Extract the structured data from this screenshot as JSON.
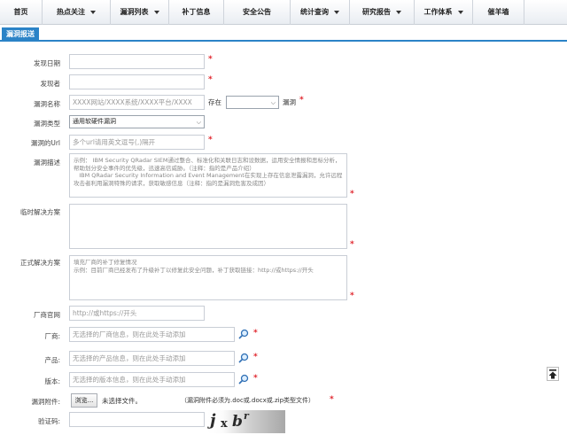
{
  "nav": {
    "items": [
      {
        "label": "首页",
        "caret": false
      },
      {
        "label": "热点关注",
        "caret": true
      },
      {
        "label": "漏洞列表",
        "caret": true
      },
      {
        "label": "补丁信息",
        "caret": false
      },
      {
        "label": "安全公告",
        "caret": false
      },
      {
        "label": "统计查询",
        "caret": true
      },
      {
        "label": "研究报告",
        "caret": true
      },
      {
        "label": "工作体系",
        "caret": true
      },
      {
        "label": "催羊墙",
        "caret": false
      }
    ]
  },
  "tab": {
    "label": "漏洞报送"
  },
  "form": {
    "discover_date": {
      "label": "发现日期",
      "value": ""
    },
    "discoverer": {
      "label": "发现者",
      "value": ""
    },
    "vuln_name": {
      "label": "漏洞名称",
      "placeholder": "XXXX网站/XXXX系统/XXXX平台/XXXX",
      "exists_label": "存在",
      "select_value": "",
      "suffix": "漏洞"
    },
    "vuln_type": {
      "label": "漏洞类型",
      "value": "通用软硬件漏洞"
    },
    "vuln_url": {
      "label": "漏洞的Url",
      "placeholder": "多个url请用英文逗号(,)隔开"
    },
    "vuln_desc": {
      "label": "漏洞描述",
      "placeholder": "示例： IBM Security QRadar SIEM通过整合、标准化和关联日志和设数据，运用安全情报和恶标分析，帮助划分安全事件的优先级，迅速高信威胁。（注释：指的是产品介绍）\n   IBM QRadar Security Information and Event Management在实现上存在信息泄露漏洞，允许远程攻击者利用漏洞特殊的请求，获取敏感信息（注释：指的是漏洞危害及成因）"
    },
    "temp_solution": {
      "label": "临时解决方案",
      "value": ""
    },
    "formal_solution": {
      "label": "正式解决方案",
      "placeholder": "填充厂商的补丁修复情况\n示例：目前厂商已经发布了升级补丁以修复此安全问题，补丁获取链接：http://或https://开头"
    },
    "vendor_url": {
      "label": "厂商官网",
      "placeholder": "http://或https://开头"
    },
    "vendor": {
      "label": "厂商:",
      "placeholder": "无选择的厂商信息，则在此处手动添加"
    },
    "product": {
      "label": "产品:",
      "placeholder": "无选择的产品信息，则在此处手动添加"
    },
    "version": {
      "label": "版本:",
      "placeholder": "无选择的版本信息，则在此处手动添加"
    },
    "attachment": {
      "label": "漏洞附件:",
      "browse_label": "浏览...",
      "file_status": "未选择文件。",
      "note": "（漏洞附件必须为.doc或.docx或.zip类型文件）"
    },
    "captcha": {
      "label": "验证码:",
      "value": "",
      "image_text": [
        "j",
        "x",
        "b",
        "r"
      ]
    }
  },
  "required_mark": "*",
  "colors": {
    "accent": "#2b83c7",
    "required": "#e0262e"
  },
  "icons": {
    "search": "search-icon",
    "scroll_top": "scroll-top-icon",
    "dropdown": "chevron-down-icon"
  }
}
